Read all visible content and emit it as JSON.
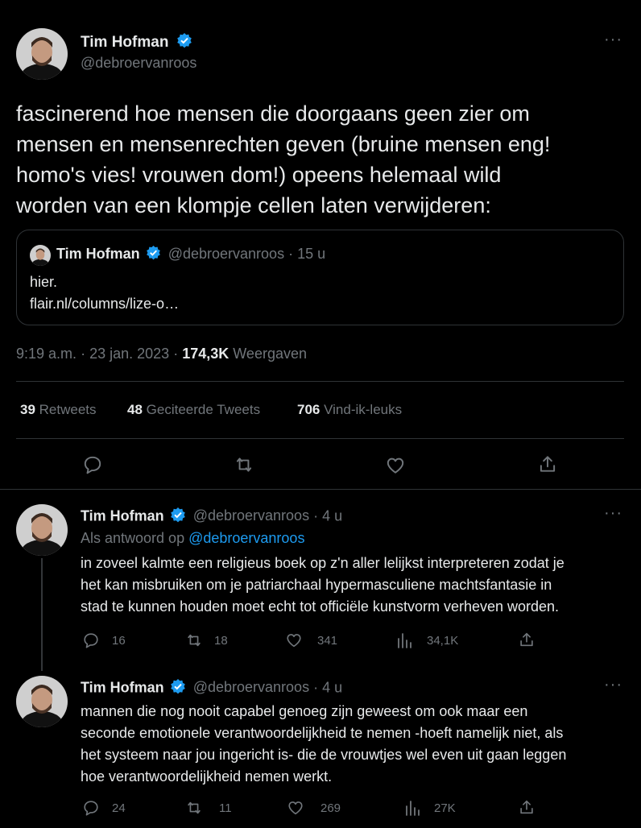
{
  "colors": {
    "background": "#000000",
    "text": "#e7e9ea",
    "muted": "#71767b",
    "accent": "#1d9bf0",
    "divider": "#2f3336"
  },
  "main_tweet": {
    "author_name": "Tim Hofman",
    "handle": "@debroervanroos",
    "more_label": "···",
    "text_lines": [
      "fascinerend hoe mensen die doorgaans geen zier om",
      "mensen en mensenrechten geven (bruine mensen eng!",
      "homo's vies! vrouwen dom!) opeens helemaal wild",
      "worden van een klompje cellen laten verwijderen:"
    ],
    "quote": {
      "author_name": "Tim Hofman",
      "handle": "@debroervanroos",
      "separator": "·",
      "time": "15 u",
      "text": "hier.",
      "link": "flair.nl/columns/lize-o…"
    },
    "time": "9:19 a.m.",
    "sep1": "·",
    "date": "23 jan. 2023",
    "sep2": "·",
    "views": "174,3K",
    "views_label": "Weergaven",
    "retweets": "39",
    "retweets_label": "Retweets",
    "quotes": "48",
    "quotes_label": "Geciteerde Tweets",
    "likes": "706",
    "likes_label": "Vind-ik-leuks",
    "actions": [
      "reply-icon",
      "retweet-icon",
      "like-icon",
      "share-icon"
    ]
  },
  "replies": [
    {
      "author_name": "Tim Hofman",
      "handle": "@debroervanroos",
      "separator": "·",
      "time": "4 u",
      "reply_to_prefix": "Als antwoord op",
      "reply_to_handle": "@debroervanroos",
      "text_lines": [
        "in zoveel kalmte een religieus boek op z'n aller lelijkst interpreteren zodat je",
        "het kan misbruiken om je patriarchaal hypermasculiene machtsfantasie in",
        "stad te kunnen houden moet echt tot officiële kunstvorm verheven worden."
      ],
      "reply_count": "16",
      "retweet_count": "18",
      "like_count": "341",
      "view_count": "34,1K"
    },
    {
      "author_name": "Tim Hofman",
      "handle": "@debroervanroos",
      "separator": "·",
      "time": "4 u",
      "text_lines": [
        "mannen die nog nooit capabel genoeg zijn geweest om ook maar een",
        "seconde emotionele verantwoordelijkheid te nemen -hoeft namelijk niet, als",
        "het systeem naar jou ingericht is- die de vrouwtjes wel even uit gaan leggen",
        "hoe verantwoordelijkheid nemen werkt."
      ],
      "reply_count": "24",
      "retweet_count": "11",
      "like_count": "269",
      "view_count": "27K"
    }
  ]
}
